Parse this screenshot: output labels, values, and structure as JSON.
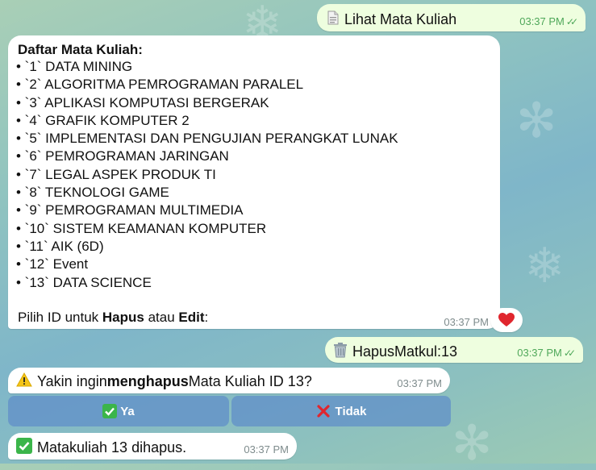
{
  "chat": {
    "msg_lihat": {
      "text": "Lihat Mata Kuliah",
      "time": "03:37 PM",
      "icon": "document-icon"
    },
    "course_list": {
      "heading": "Daftar Mata Kuliah:",
      "items": [
        "• `1` DATA MINING",
        "• `2` ALGORITMA PEMROGRAMAN PARALEL",
        "• `3` APLIKASI KOMPUTASI BERGERAK",
        "• `4` GRAFIK KOMPUTER 2",
        "• `5` IMPLEMENTASI DAN PENGUJIAN PERANGKAT LUNAK",
        "• `6` PEMROGRAMAN JARINGAN",
        "• `7` LEGAL ASPEK PRODUK TI",
        "• `8` TEKNOLOGI GAME",
        "• `9` PEMROGRAMAN MULTIMEDIA",
        "• `10` SISTEM KEAMANAN KOMPUTER",
        "• `11` AIK (6D)",
        "• `12` Event",
        "• `13` DATA SCIENCE"
      ],
      "prompt_pre": "Pilih ID untuk ",
      "prompt_b1": "Hapus",
      "prompt_mid": " atau ",
      "prompt_b2": "Edit",
      "prompt_post": ":",
      "time": "03:37 PM",
      "reaction": "heart"
    },
    "msg_hapus": {
      "text": "HapusMatkul:13",
      "time": "03:37 PM",
      "icon": "trash-icon"
    },
    "confirm": {
      "pre": "Yakin ingin ",
      "bold": "menghapus",
      "post": " Mata Kuliah ID 13?",
      "time": "03:37 PM",
      "icon": "warning-icon"
    },
    "buttons": {
      "yes": "Ya",
      "no": "Tidak"
    },
    "deleted": {
      "text": "Matakuliah 13 dihapus.",
      "time": "03:37 PM",
      "icon": "check-icon"
    }
  },
  "colors": {
    "outgoing_bubble": "#eefedf",
    "incoming_bubble": "#ffffff",
    "read_ticks": "#4fa85a",
    "button_bg": "#608fc8"
  }
}
